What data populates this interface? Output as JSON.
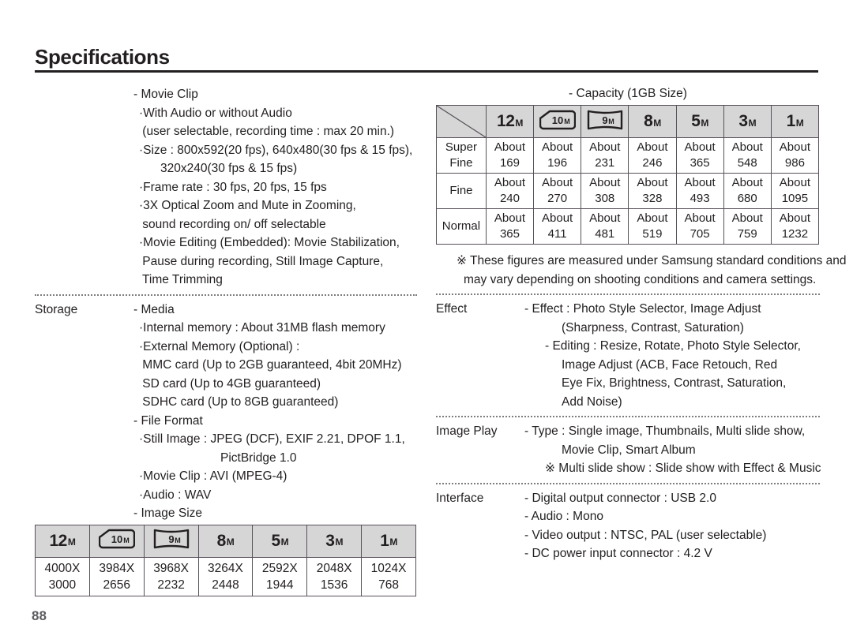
{
  "page": {
    "title": "Specifications",
    "number": "88"
  },
  "left_column": {
    "movie_clip": {
      "label": "",
      "lines": [
        {
          "indent": "i2",
          "text": "- Movie Clip"
        },
        {
          "indent": "i3",
          "text": "·With Audio or without Audio"
        },
        {
          "indent": "i3",
          "text": " (user selectable, recording time : max 20 min.)"
        },
        {
          "indent": "i3",
          "text": "·Size : 800x592(20 fps), 640x480(30 fps & 15 fps),"
        },
        {
          "indent": "i6",
          "text": "320x240(30 fps & 15 fps)"
        },
        {
          "indent": "i3",
          "text": "·Frame rate : 30 fps, 20 fps, 15 fps"
        },
        {
          "indent": "i3",
          "text": "·3X Optical Zoom and Mute in Zooming,"
        },
        {
          "indent": "i3",
          "text": " sound recording on/ off selectable"
        },
        {
          "indent": "i3",
          "text": "·Movie Editing (Embedded): Movie Stabilization,"
        },
        {
          "indent": "i3",
          "text": " Pause during recording, Still Image Capture,"
        },
        {
          "indent": "i3",
          "text": " Time Trimming"
        }
      ]
    },
    "storage": {
      "label": "Storage",
      "lines": [
        {
          "indent": "i2",
          "text": "- Media"
        },
        {
          "indent": "i3",
          "text": "·Internal memory : About 31MB flash memory"
        },
        {
          "indent": "i3",
          "text": "·External Memory (Optional) :"
        },
        {
          "indent": "i3",
          "text": " MMC card (Up to 2GB guaranteed, 4bit 20MHz)"
        },
        {
          "indent": "i3",
          "text": " SD card (Up to 4GB guaranteed)"
        },
        {
          "indent": "i3",
          "text": " SDHC card (Up to 8GB guaranteed)"
        },
        {
          "indent": "i2",
          "text": "- File Format"
        },
        {
          "indent": "i3",
          "text": "·Still Image : JPEG (DCF), EXIF 2.21, DPOF 1.1,"
        },
        {
          "indent": "i5",
          "text": "PictBridge 1.0"
        },
        {
          "indent": "i3",
          "text": "·Movie Clip : AVI (MPEG-4)"
        },
        {
          "indent": "i3",
          "text": "·Audio : WAV"
        },
        {
          "indent": "i2",
          "text": "- Image Size"
        }
      ]
    },
    "image_size_table": {
      "headers": [
        {
          "icon": "res-12m-icon",
          "label": "12",
          "suffix": "M",
          "style": "plain"
        },
        {
          "icon": "res-10m-icon",
          "label": "10",
          "suffix": "M",
          "style": "clipped-frame"
        },
        {
          "icon": "res-9m-icon",
          "label": "9",
          "suffix": "M",
          "style": "wide-frame"
        },
        {
          "icon": "res-8m-icon",
          "label": "8",
          "suffix": "M",
          "style": "plain"
        },
        {
          "icon": "res-5m-icon",
          "label": "5",
          "suffix": "M",
          "style": "plain"
        },
        {
          "icon": "res-3m-icon",
          "label": "3",
          "suffix": "M",
          "style": "plain"
        },
        {
          "icon": "res-1m-icon",
          "label": "1",
          "suffix": "M",
          "style": "plain"
        }
      ],
      "values": [
        "4000X\n3000",
        "3984X\n2656",
        "3968X\n2232",
        "3264X\n2448",
        "2592X\n1944",
        "2048X\n1536",
        "1024X\n768"
      ]
    }
  },
  "right_column": {
    "capacity_caption": "- Capacity (1GB Size)",
    "capacity_table": {
      "corner": "",
      "headers": [
        {
          "icon": "res-12m-icon",
          "label": "12",
          "suffix": "M",
          "style": "plain"
        },
        {
          "icon": "res-10m-icon",
          "label": "10",
          "suffix": "M",
          "style": "clipped-frame"
        },
        {
          "icon": "res-9m-icon",
          "label": "9",
          "suffix": "M",
          "style": "wide-frame"
        },
        {
          "icon": "res-8m-icon",
          "label": "8",
          "suffix": "M",
          "style": "plain"
        },
        {
          "icon": "res-5m-icon",
          "label": "5",
          "suffix": "M",
          "style": "plain"
        },
        {
          "icon": "res-3m-icon",
          "label": "3",
          "suffix": "M",
          "style": "plain"
        },
        {
          "icon": "res-1m-icon",
          "label": "1",
          "suffix": "M",
          "style": "plain"
        }
      ],
      "rows": [
        {
          "label": "Super\nFine",
          "values": [
            "About\n169",
            "About\n196",
            "About\n231",
            "About\n246",
            "About\n365",
            "About\n548",
            "About\n986"
          ]
        },
        {
          "label": "Fine",
          "values": [
            "About\n240",
            "About\n270",
            "About\n308",
            "About\n328",
            "About\n493",
            "About\n680",
            "About\n1095"
          ]
        },
        {
          "label": "Normal",
          "values": [
            "About\n365",
            "About\n411",
            "About\n481",
            "About\n519",
            "About\n705",
            "About\n759",
            "About\n1232"
          ]
        }
      ]
    },
    "capacity_note": {
      "lines": [
        {
          "indent": "i8",
          "text": "※ These figures are measured under Samsung standard conditions and"
        },
        {
          "indent": "i7",
          "text": "may vary depending on shooting conditions and camera settings."
        }
      ]
    },
    "effect": {
      "label": "Effect",
      "lines": [
        {
          "indent": "i1",
          "text": "- Effect : Photo Style Selector, Image Adjust"
        },
        {
          "indent": "i6",
          "text": "(Sharpness, Contrast, Saturation)"
        },
        {
          "indent": "i8",
          "text": "- Editing : Resize, Rotate, Photo Style Selector,"
        },
        {
          "indent": "i6",
          "text": "Image Adjust (ACB, Face Retouch, Red"
        },
        {
          "indent": "i6",
          "text": "Eye Fix, Brightness, Contrast, Saturation,"
        },
        {
          "indent": "i6",
          "text": "Add Noise)"
        }
      ]
    },
    "image_play": {
      "label": "Image Play",
      "lines": [
        {
          "indent": "i1",
          "text": "- Type : Single image, Thumbnails, Multi slide show,"
        },
        {
          "indent": "i6",
          "text": "Movie Clip, Smart Album"
        },
        {
          "indent": "i8",
          "text": "※ Multi slide show : Slide show with Effect & Music"
        }
      ]
    },
    "interface": {
      "label": "Interface",
      "lines": [
        {
          "indent": "i1",
          "text": "- Digital output connector : USB 2.0"
        },
        {
          "indent": "i1",
          "text": "- Audio : Mono"
        },
        {
          "indent": "i1",
          "text": "- Video output : NTSC, PAL (user selectable)"
        },
        {
          "indent": "i1",
          "text": "- DC power input connector : 4.2 V"
        }
      ]
    }
  },
  "colors": {
    "text": "#231f20",
    "header_fill": "#d6d6d6",
    "table_border": "#58505a",
    "separator": "#7d7d7d",
    "page_number": "#5b5b60"
  }
}
